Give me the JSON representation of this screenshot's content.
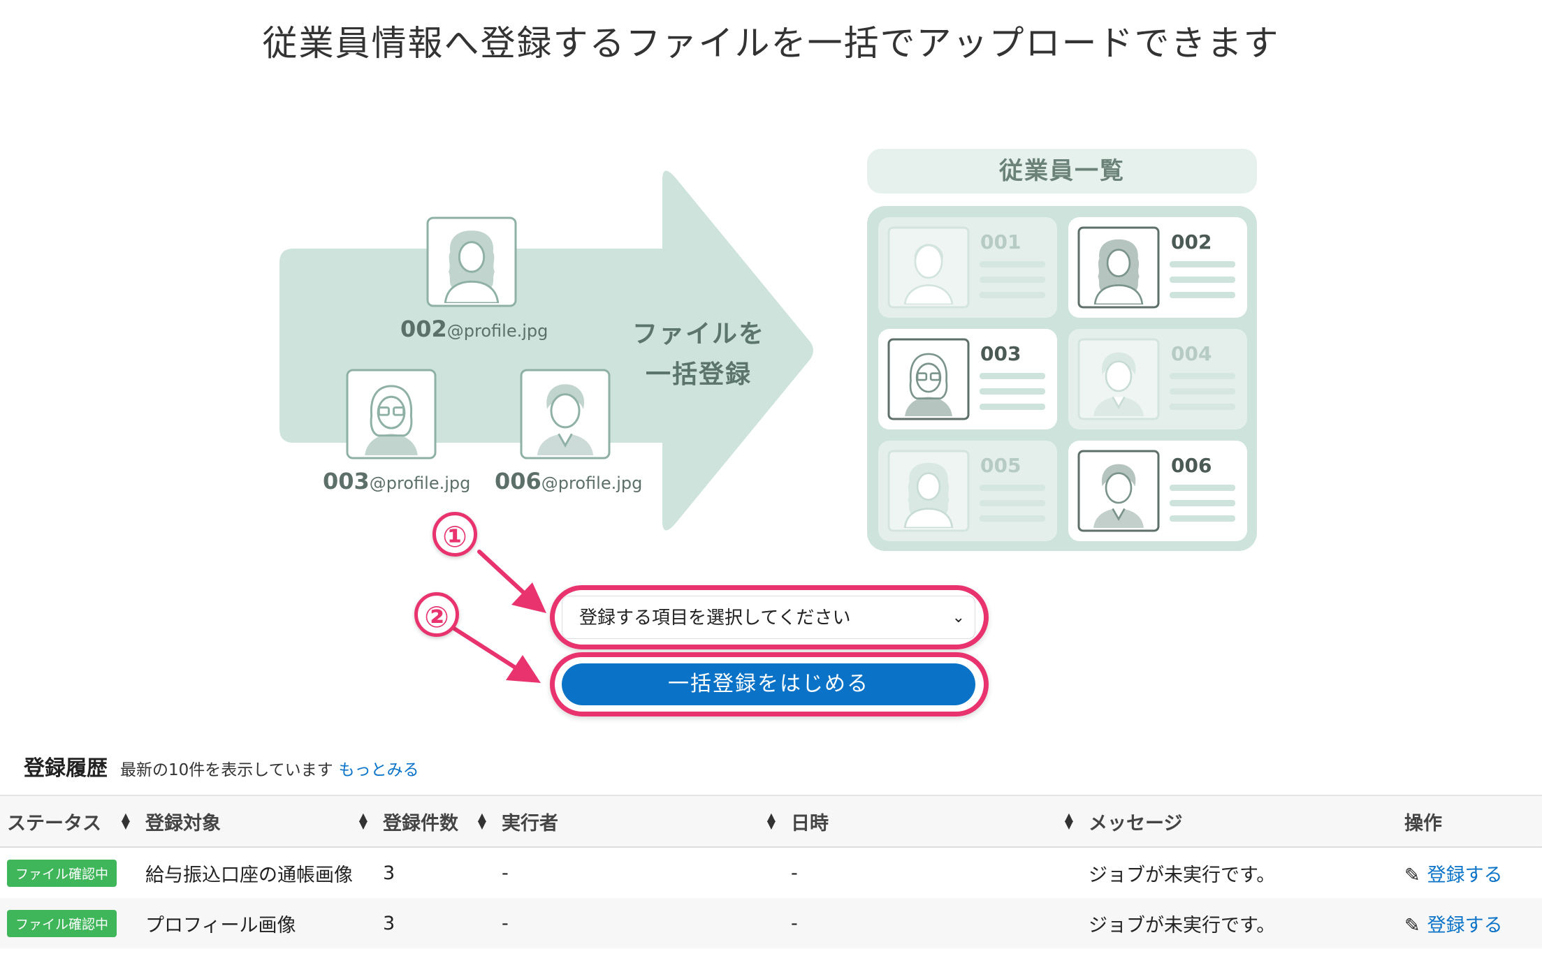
{
  "page_title": "従業員情報へ登録するファイルを一括でアップロードできます",
  "illustration": {
    "files": [
      {
        "id": "002",
        "suffix": "@profile.jpg"
      },
      {
        "id": "003",
        "suffix": "@profile.jpg"
      },
      {
        "id": "006",
        "suffix": "@profile.jpg"
      }
    ],
    "arrow_text_line1": "ファイルを",
    "arrow_text_line2": "一括登録",
    "list_title": "従業員一覧",
    "employees": [
      {
        "id": "001",
        "active": false
      },
      {
        "id": "002",
        "active": true
      },
      {
        "id": "003",
        "active": true
      },
      {
        "id": "004",
        "active": false
      },
      {
        "id": "005",
        "active": false
      },
      {
        "id": "006",
        "active": true
      }
    ]
  },
  "steps": {
    "step1": "①",
    "step2": "②"
  },
  "form": {
    "select_value": "登録する項目を選択してください",
    "submit_label": "一括登録をはじめる"
  },
  "history": {
    "title": "登録履歴",
    "note": "最新の10件を表示しています",
    "more_link": "もっとみる",
    "columns": [
      "ステータス",
      "登録対象",
      "登録件数",
      "実行者",
      "日時",
      "メッセージ",
      "操作"
    ],
    "rows": [
      {
        "status": "ファイル確認中",
        "target": "給与振込口座の通帳画像",
        "count": "3",
        "executor": "-",
        "datetime": "-",
        "message": "ジョブが未実行です。",
        "action": "登録する"
      },
      {
        "status": "ファイル確認中",
        "target": "プロフィール画像",
        "count": "3",
        "executor": "-",
        "datetime": "-",
        "message": "ジョブが未実行です。",
        "action": "登録する"
      }
    ]
  },
  "colors": {
    "accent": "#e8336e",
    "primary": "#0a73c8",
    "mint": "#cde3dc",
    "status_green": "#3fb65a"
  }
}
